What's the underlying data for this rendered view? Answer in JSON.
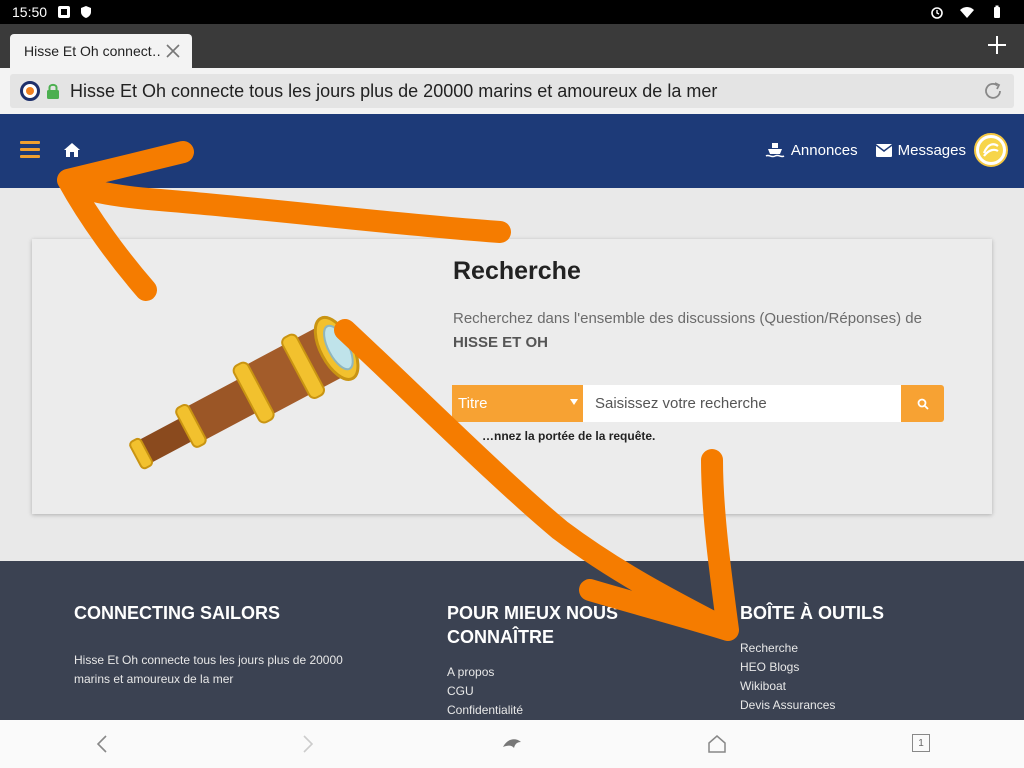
{
  "status_bar": {
    "time": "15:50"
  },
  "browser": {
    "tab_title": "Hisse Et Oh connect…",
    "address": "Hisse Et Oh connecte tous les jours plus de 20000 marins et amoureux de la mer",
    "tab_count": "1"
  },
  "navbar": {
    "annonces_label": "Annonces",
    "messages_label": "Messages"
  },
  "search": {
    "title": "Recherche",
    "description": "Recherchez dans l'ensemble des discussions (Question/Réponses) de",
    "description_bold": "HISSE ET OH",
    "select_value": "Titre",
    "placeholder": "Saisissez votre recherche",
    "hint": "…nnez la portée de la requête."
  },
  "footer": {
    "col1": {
      "heading": "CONNECTING SAILORS",
      "text": "Hisse Et Oh connecte tous les jours plus de 20000 marins et amoureux de la mer"
    },
    "col2": {
      "heading": "POUR MIEUX NOUS CONNAÎTRE",
      "links": [
        "A propos",
        "CGU",
        "Confidentialité"
      ]
    },
    "col3": {
      "heading": "BOÎTE À OUTILS",
      "links": [
        "Recherche",
        "HEO Blogs",
        "Wikiboat",
        "Devis Assurances"
      ]
    }
  },
  "colors": {
    "navbar": "#1d3a78",
    "accent": "#f7a233",
    "footer": "#3b4252",
    "annotation": "#f57c00"
  }
}
